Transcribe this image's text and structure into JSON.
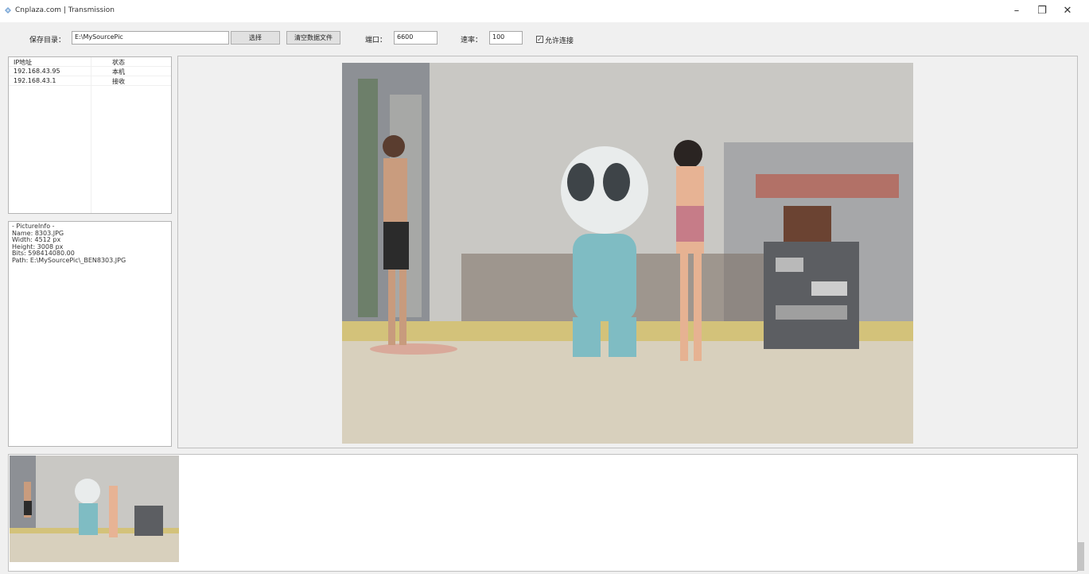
{
  "window": {
    "title": "Cnplaza.com | Transmission",
    "minimize_glyph": "–",
    "restore_glyph": "❐",
    "close_glyph": "✕"
  },
  "toolbar": {
    "save_dir_label": "保存目录：",
    "save_dir_value": "E:\\MySourcePic",
    "browse_button": "选择",
    "clear_button": "清空数据文件",
    "port_label": "端口：",
    "port_value": "6600",
    "speed_label": "速率：",
    "speed_value": "100",
    "allow_connect_label": "允许连接",
    "allow_connect_checked": true
  },
  "ip_table": {
    "headers": {
      "ip": "IP地址",
      "status": "状态"
    },
    "rows": [
      {
        "ip": "192.168.43.95",
        "status": "本机"
      },
      {
        "ip": "192.168.43.1",
        "status": "接收"
      }
    ]
  },
  "picture_info": {
    "lines": [
      "- PictureInfo -",
      "Name: 8303.JPG",
      "Width: 4512 px",
      "Height: 3008 px",
      "Bits: 598414080.00",
      "Path: E:\\MySourcePic\\_BEN8303.JPG"
    ]
  },
  "icons": {
    "app": "app-icon",
    "checkbox": "checkbox-checked-icon"
  },
  "colors": {
    "window_bg": "#f0f0f0",
    "panel_bg": "#ffffff",
    "border": "#b5b5b5"
  }
}
